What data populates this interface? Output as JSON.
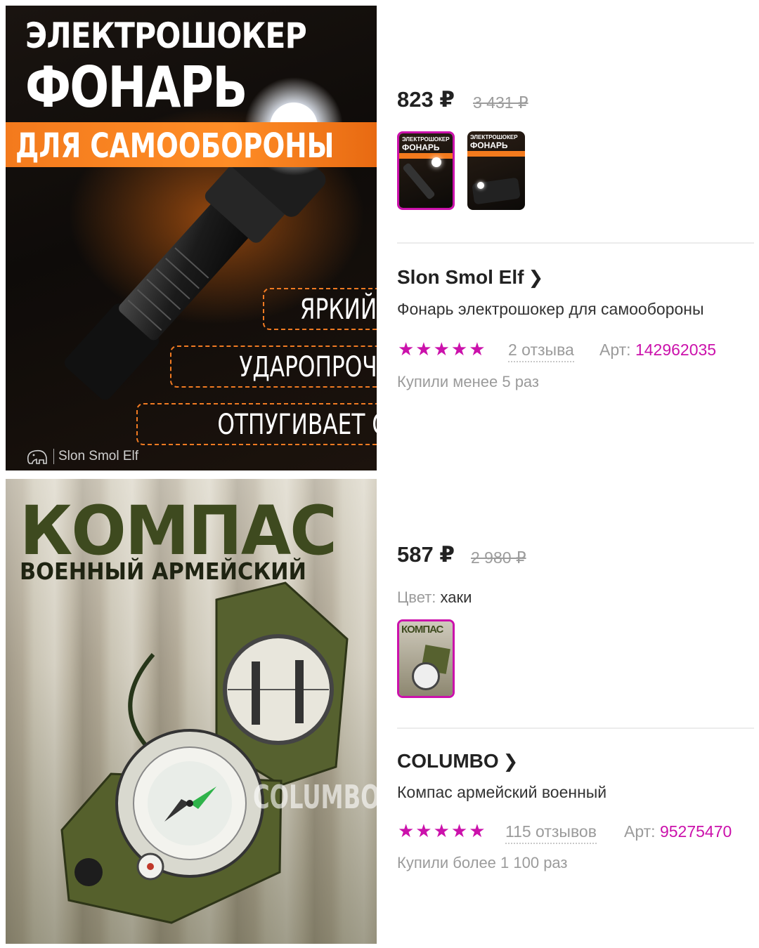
{
  "product1": {
    "image": {
      "title_line1": "ЭЛЕКТРОШОКЕР",
      "title_line2": "ФОНАРЬ",
      "band_text": "ДЛЯ САМООБОРОНЫ",
      "features": [
        "ЯРКИЙ",
        "УДАРОПРОЧНЫЙ",
        "ОТПУГИВАЕТ СОБАК"
      ],
      "brand_mark": "Slon Smol Elf"
    },
    "price": "823 ₽",
    "old_price": "3 431 ₽",
    "brand": "Slon Smol Elf",
    "name": "Фонарь электрошокер для самообороны",
    "rating_stars": "★★★★★",
    "rating": 5,
    "reviews": "2 отзыва",
    "article_label": "Арт:",
    "article": "142962035",
    "bought": "Купили менее 5 раз",
    "thumbs": [
      {
        "line1": "ЭЛЕКТРОШОКЕР",
        "line2": "ФОНАРЬ",
        "selected": true
      },
      {
        "line1": "ЭЛЕКТРОШОКЕР",
        "line2": "ФОНАРЬ",
        "selected": false
      }
    ]
  },
  "product2": {
    "image": {
      "title": "КОМПАС",
      "subtitle": "ВОЕННЫЙ АРМЕЙСКИЙ",
      "watermark": "COLUMBO"
    },
    "price": "587 ₽",
    "old_price": "2 980 ₽",
    "color_label": "Цвет:",
    "color_value": "хаки",
    "brand": "COLUMBO",
    "name": "Компас армейский военный",
    "rating_stars": "★★★★★",
    "rating": 5,
    "reviews": "115 отзывов",
    "article_label": "Арт:",
    "article": "95275470",
    "bought": "Купили более 1 100 раз",
    "thumbs": [
      {
        "line1": "КОМПАС",
        "selected": true
      }
    ]
  },
  "colors": {
    "accent": "#cb11ab",
    "text": "#222222",
    "muted": "#9b9b9b",
    "flash_orange": "#f37a1d",
    "army_green": "#3e4a1f"
  },
  "icons": [
    "chevron-right-icon",
    "star-icon",
    "elephant-logo-icon"
  ]
}
